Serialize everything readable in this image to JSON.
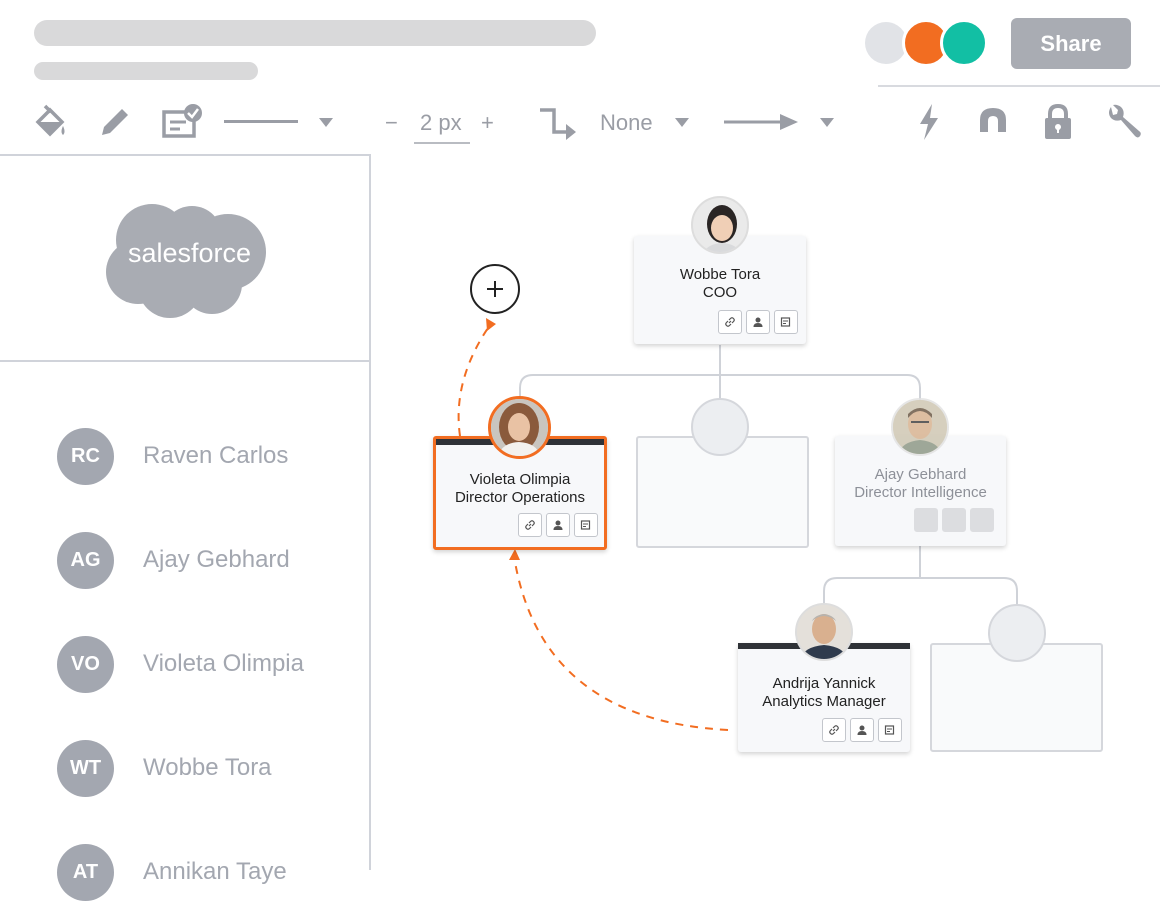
{
  "toolbar": {
    "share_label": "Share",
    "line_width": "2 px",
    "minus": "−",
    "plus": "+",
    "endpoint": "None"
  },
  "collaborators": [
    {
      "color": "#e1e3e7"
    },
    {
      "color": "#f26d21"
    },
    {
      "color": "#12bfa4"
    }
  ],
  "sidebar": {
    "logo_text": "salesforce",
    "people": [
      {
        "initials": "RC",
        "name": "Raven Carlos"
      },
      {
        "initials": "AG",
        "name": "Ajay Gebhard"
      },
      {
        "initials": "VO",
        "name": "Violeta Olimpia"
      },
      {
        "initials": "WT",
        "name": "Wobbe Tora"
      },
      {
        "initials": "AT",
        "name": "Annikan Taye"
      }
    ]
  },
  "org": {
    "coo": {
      "name": "Wobbe Tora",
      "role": "COO"
    },
    "director_ops": {
      "name": "Violeta Olimpia",
      "role": "Director Operations"
    },
    "director_intel": {
      "name": "Ajay Gebhard",
      "role": "Director Intelligence"
    },
    "analytics": {
      "name": "Andrija Yannick",
      "role": "Analytics Manager"
    }
  },
  "colors": {
    "accent": "#f26d21",
    "teal": "#12bfa4",
    "muted": "#a3a7b0"
  }
}
